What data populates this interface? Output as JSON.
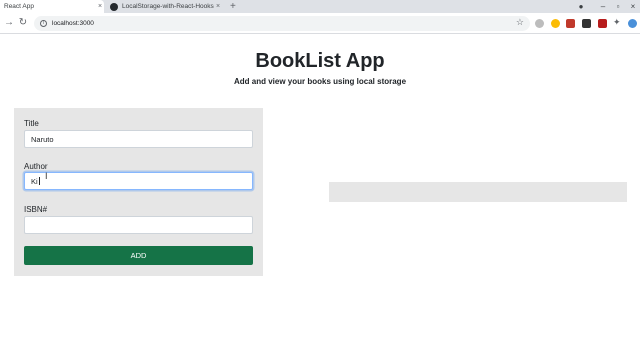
{
  "browser": {
    "tabs": [
      {
        "title": "React App",
        "close": "×",
        "active": true
      },
      {
        "title": "LocalStorage-with-React-Hooks",
        "close": "×",
        "active": false
      }
    ],
    "new_tab": "+",
    "url": "localhost:3000",
    "window_controls": [
      "–",
      "▫",
      "×"
    ]
  },
  "page": {
    "title": "BookList App",
    "subtitle": "Add and view your books using local storage"
  },
  "form": {
    "title": {
      "label": "Title",
      "value": "Naruto"
    },
    "author": {
      "label": "Author",
      "value": "Ki"
    },
    "isbn": {
      "label": "ISBN#",
      "value": ""
    },
    "submit_label": "ADD"
  },
  "colors": {
    "panel": "#e6e6e6",
    "button": "#157347",
    "focus": "#86b7fe"
  }
}
